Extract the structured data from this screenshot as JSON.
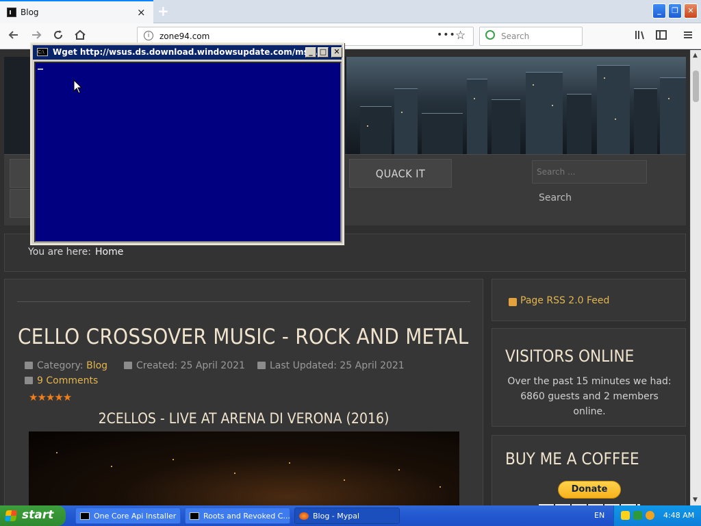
{
  "browser": {
    "tab_title": "Blog",
    "tab_close": "×",
    "new_tab": "+",
    "url": "zone94.com",
    "url_menu": "•••",
    "search_placeholder": "Search",
    "window_controls": {
      "minimize": "_",
      "maximize": "❐",
      "close": "✕"
    },
    "nav_icons": [
      "back-icon",
      "forward-icon",
      "reload-icon",
      "home-icon",
      "library-icon",
      "sidebar-icon",
      "menu-icon"
    ]
  },
  "page": {
    "menu": {
      "quack_it": "QUACK IT"
    },
    "site_search": {
      "placeholder": "Search ...",
      "button": "Search"
    },
    "breadcrumb": {
      "label": "You are here:",
      "home": "Home"
    },
    "article": {
      "title": "CELLO CROSSOVER MUSIC - ROCK AND METAL",
      "category_label": "Category:",
      "category": "Blog",
      "created": "Created: 25 April 2021",
      "updated": "Last Updated: 25 April 2021",
      "comments": "9 Comments",
      "stars": "★★★★★",
      "rating": 5,
      "subtitle": "2CELLOS - LIVE AT ARENA DI VERONA (2016)"
    },
    "sidebar": {
      "rss": "Page RSS 2.0 Feed",
      "visitors_title": "VISITORS ONLINE",
      "visitors_text": "Over the past 15 minutes we had: 6860 guests and 2 members online.",
      "coffee_title": "BUY ME A COFFEE",
      "donate": "Donate"
    }
  },
  "console": {
    "title": "Wget http://wsus.ds.download.windowsupdate.com/msd...",
    "icon_text": "C:\\",
    "controls": {
      "minimize": "_",
      "maximize": "□",
      "close": "✕"
    }
  },
  "taskbar": {
    "start": "start",
    "tasks": [
      {
        "label": "One Core Api Installer",
        "icon": "console-icon"
      },
      {
        "label": "Roots and Revoked C...",
        "icon": "console-icon"
      },
      {
        "label": "Blog - Mypal",
        "icon": "browser-icon"
      }
    ],
    "language": "EN",
    "clock": "4:48 AM"
  },
  "colors": {
    "console_bg": "#000080",
    "titlebar": "#0a246a",
    "accent_gold": "#e3b64e",
    "heading": "#f0e4cf",
    "taskbar": "#245ad2",
    "start_green": "#3c9e3c"
  }
}
